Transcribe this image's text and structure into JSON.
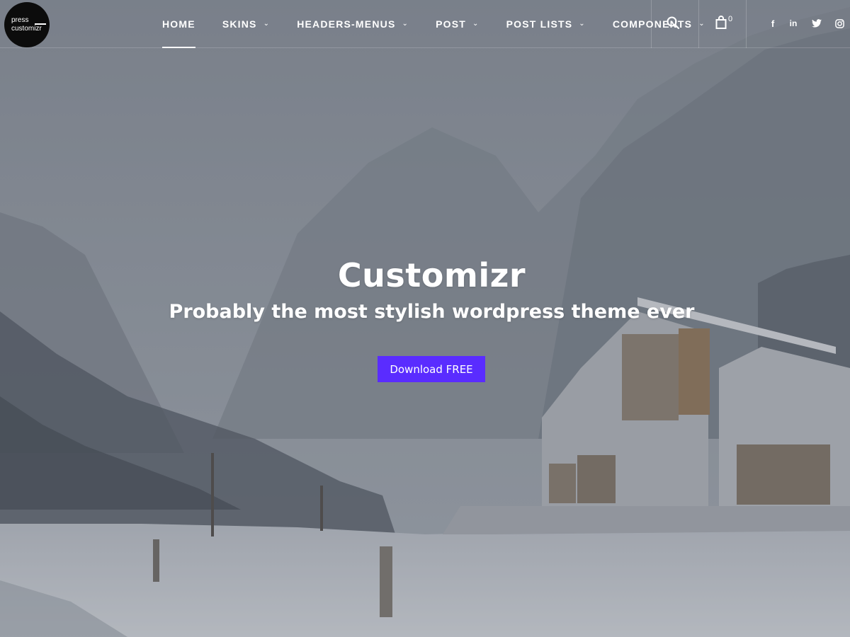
{
  "logo": {
    "line1": "press",
    "line2": "customizr"
  },
  "nav": {
    "items": [
      {
        "label": "HOME",
        "active": true,
        "has_submenu": false
      },
      {
        "label": "SKINS",
        "active": false,
        "has_submenu": true
      },
      {
        "label": "HEADERS-MENUS",
        "active": false,
        "has_submenu": true
      },
      {
        "label": "POST",
        "active": false,
        "has_submenu": true
      },
      {
        "label": "POST LISTS",
        "active": false,
        "has_submenu": true
      },
      {
        "label": "COMPONENTS",
        "active": false,
        "has_submenu": true
      }
    ]
  },
  "header": {
    "search_icon": "search-icon",
    "cart_icon": "shopping-bag-icon",
    "cart_count": "0",
    "social": [
      {
        "name": "facebook-icon",
        "glyph": "f"
      },
      {
        "name": "linkedin-icon",
        "glyph": "in"
      },
      {
        "name": "twitter-icon",
        "glyph": "twitter"
      },
      {
        "name": "instagram-icon",
        "glyph": "instagram"
      }
    ]
  },
  "hero": {
    "title": "Customizr",
    "subtitle": "Probably the most stylish wordpress theme ever",
    "cta_label": "Download FREE"
  },
  "colors": {
    "cta": "#5a2cff",
    "logo_bg": "#0c0c0c",
    "text": "#ffffff"
  }
}
